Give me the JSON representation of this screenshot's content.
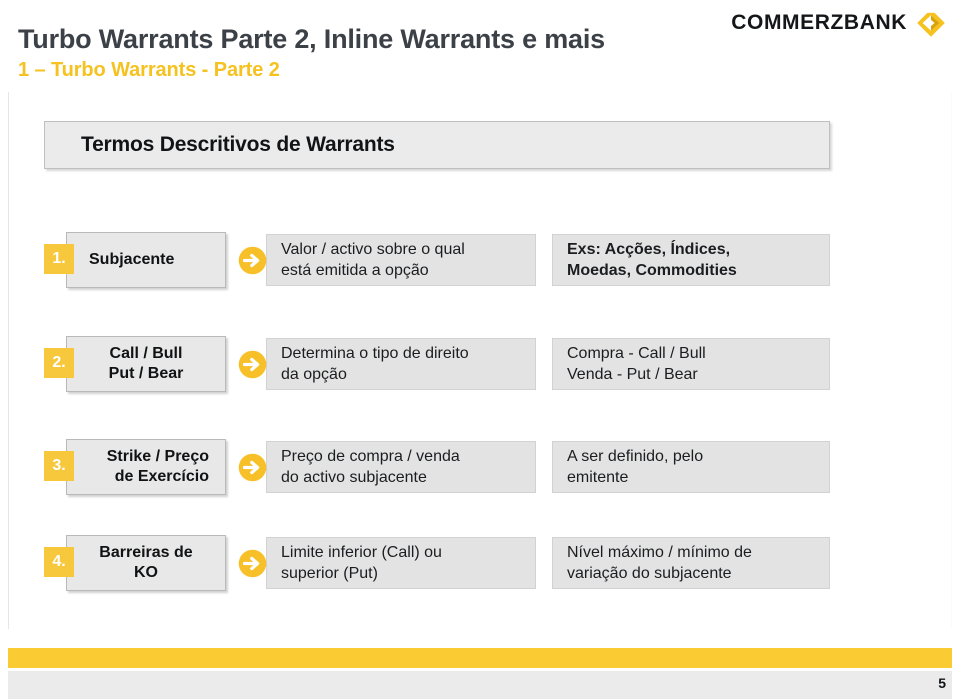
{
  "header": {
    "title": "Turbo Warrants Parte 2, Inline Warrants e mais",
    "subtitle": "1 – Turbo Warrants - Parte 2",
    "logo_text": "COMMERZBANK",
    "logo_icon": "commerzbank-chevron-icon"
  },
  "section": {
    "title": "Termos Descritivos de Warrants"
  },
  "rows": [
    {
      "number": "1.",
      "label_lines": [
        "Subjacente"
      ],
      "label_align": "pad-left",
      "arrow_icon": "arrow-right-circle-icon",
      "description_lines": [
        "Valor / activo sobre o qual",
        "está emitida a opção"
      ],
      "example_lines": [
        "Exs: Acções, Índices,",
        "Moedas, Commodities"
      ],
      "example_bold": true
    },
    {
      "number": "2.",
      "label_lines": [
        "Call / Bull",
        "Put / Bear"
      ],
      "label_align": "center",
      "arrow_icon": "arrow-right-circle-icon",
      "description_lines": [
        "Determina o tipo de direito",
        "da opção"
      ],
      "example_lines": [
        "Compra - Call / Bull",
        "Venda - Put / Bear"
      ],
      "example_bold": false
    },
    {
      "number": "3.",
      "label_lines": [
        "Strike / Preço",
        "de Exercício"
      ],
      "label_align": "align-right",
      "arrow_icon": "arrow-right-circle-icon",
      "description_lines": [
        "Preço de compra / venda",
        "do activo subjacente"
      ],
      "example_lines": [
        "A ser definido, pelo",
        "emitente"
      ],
      "example_bold": false
    },
    {
      "number": "4.",
      "label_lines": [
        "Barreiras de",
        "KO"
      ],
      "label_align": "center",
      "arrow_icon": "arrow-right-circle-icon",
      "description_lines": [
        "Limite inferior (Call) ou",
        "superior (Put)"
      ],
      "example_lines": [
        "Nível máximo / mínimo de",
        "variação do subjacente"
      ],
      "example_bold": false
    }
  ],
  "footer": {
    "page_number": "5"
  },
  "colors": {
    "brand_yellow": "#fbcb34",
    "badge_yellow": "#f8c83c",
    "subtitle_yellow": "#f5c220",
    "title_gray": "#3c4148",
    "box_gray": "#e3e3e3",
    "label_gray": "#e8e8e8"
  }
}
